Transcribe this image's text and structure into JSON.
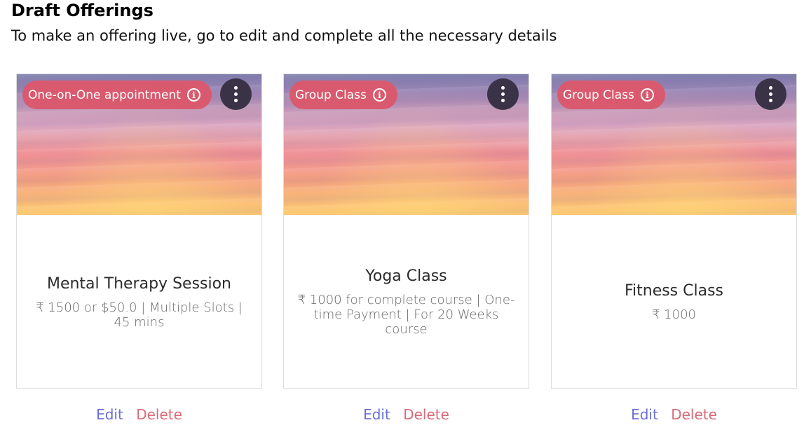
{
  "header": {
    "title": "Draft Offerings",
    "subtitle": "To make an offering live, go to edit and complete all the necessary details"
  },
  "colors": {
    "badge": "#d95a6e",
    "menu_button": "#3a3347",
    "edit_link": "#6b6ed8",
    "delete_link": "#d96a78"
  },
  "cards": [
    {
      "type_label": "One-on-One appointment",
      "title": "Mental Therapy Session",
      "description": "₹ 1500 or $50.0 | Multiple Slots | 45 mins",
      "edit_label": "Edit",
      "delete_label": "Delete"
    },
    {
      "type_label": "Group Class",
      "title": "Yoga Class",
      "description": "₹ 1000 for complete course | One-time Payment | For 20 Weeks course",
      "edit_label": "Edit",
      "delete_label": "Delete"
    },
    {
      "type_label": "Group Class",
      "title": "Fitness Class",
      "description": "₹ 1000",
      "edit_label": "Edit",
      "delete_label": "Delete"
    }
  ],
  "icons": {
    "info": "info-icon",
    "menu": "more-vertical-icon"
  }
}
